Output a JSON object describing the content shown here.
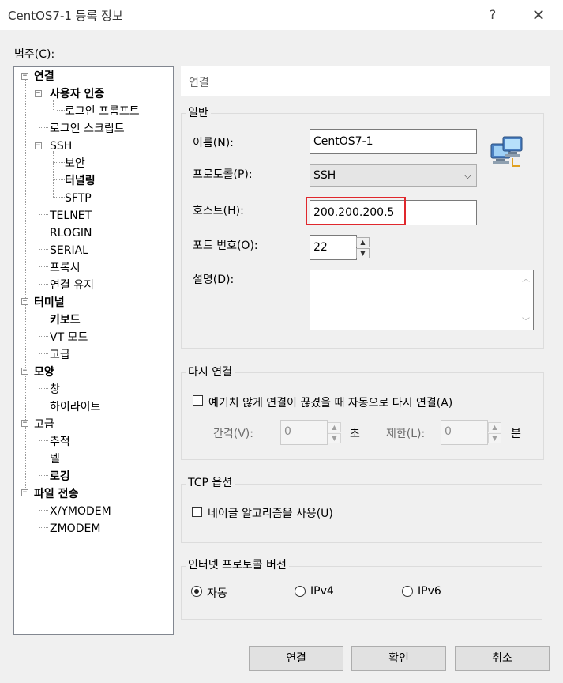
{
  "window": {
    "title": "CentOS7-1 등록 정보",
    "help_glyph": "?",
    "close_glyph": "✕"
  },
  "category_label": "범주(C):",
  "tree": {
    "expand_glyph": "−",
    "items": [
      {
        "label": "연결",
        "bold": true
      },
      {
        "label": "사용자 인증",
        "bold": true
      },
      {
        "label": "로그인 프롬프트",
        "bold": false
      },
      {
        "label": "로그인 스크립트",
        "bold": false
      },
      {
        "label": "SSH",
        "bold": false
      },
      {
        "label": "보안",
        "bold": false
      },
      {
        "label": "터널링",
        "bold": true
      },
      {
        "label": "SFTP",
        "bold": false
      },
      {
        "label": "TELNET",
        "bold": false
      },
      {
        "label": "RLOGIN",
        "bold": false
      },
      {
        "label": "SERIAL",
        "bold": false
      },
      {
        "label": "프록시",
        "bold": false
      },
      {
        "label": "연결 유지",
        "bold": false
      },
      {
        "label": "터미널",
        "bold": true
      },
      {
        "label": "키보드",
        "bold": true
      },
      {
        "label": "VT 모드",
        "bold": false
      },
      {
        "label": "고급",
        "bold": false
      },
      {
        "label": "모양",
        "bold": true
      },
      {
        "label": "창",
        "bold": false
      },
      {
        "label": "하이라이트",
        "bold": false
      },
      {
        "label": "고급",
        "bold": false
      },
      {
        "label": "추적",
        "bold": false
      },
      {
        "label": "벨",
        "bold": false
      },
      {
        "label": "로깅",
        "bold": true
      },
      {
        "label": "파일 전송",
        "bold": true
      },
      {
        "label": "X/YMODEM",
        "bold": false
      },
      {
        "label": "ZMODEM",
        "bold": false
      }
    ]
  },
  "section_title": "연결",
  "general": {
    "title": "일반",
    "name_label": "이름(N):",
    "name_value": "CentOS7-1",
    "protocol_label": "프로토콜(P):",
    "protocol_value": "SSH",
    "host_label": "호스트(H):",
    "host_value": "200.200.200.5",
    "port_label": "포트 번호(O):",
    "port_value": "22",
    "desc_label": "설명(D):",
    "desc_value": ""
  },
  "reconnect": {
    "title": "다시 연결",
    "checkbox_label": "예기치 않게 연결이 끊겼을 때 자동으로 다시 연결(A)",
    "interval_label": "간격(V):",
    "interval_value": "0",
    "interval_unit": "초",
    "limit_label": "제한(L):",
    "limit_value": "0",
    "limit_unit": "분"
  },
  "tcp": {
    "title": "TCP 옵션",
    "nagle_label": "네이글 알고리즘을 사용(U)"
  },
  "ip": {
    "title": "인터넷 프로토콜 버전",
    "options": [
      "자동",
      "IPv4",
      "IPv6"
    ],
    "selected": "자동"
  },
  "buttons": {
    "connect": "연결",
    "ok": "확인",
    "cancel": "취소"
  },
  "glyphs": {
    "spin_up": "▲",
    "spin_down": "▼",
    "combo_arrow": "⌵",
    "scroll_up": "︿",
    "scroll_down": "﹀"
  },
  "colors": {
    "highlight": "#e0282d",
    "window_bg": "#f0f0f0"
  }
}
